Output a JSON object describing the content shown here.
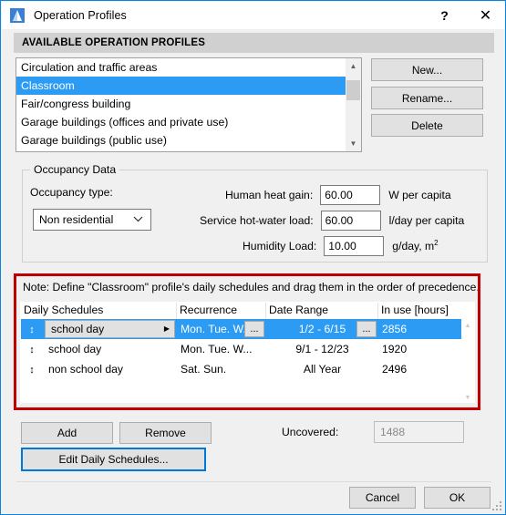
{
  "window": {
    "title": "Operation Profiles",
    "icon": "app-triangle-icon",
    "help_label": "?",
    "close_label": "✕"
  },
  "section": {
    "header": "AVAILABLE OPERATION PROFILES"
  },
  "profiles": {
    "items": [
      {
        "label": "Circulation and traffic areas",
        "selected": false
      },
      {
        "label": "Classroom",
        "selected": true
      },
      {
        "label": "Fair/congress building",
        "selected": false
      },
      {
        "label": "Garage buildings (offices and private use)",
        "selected": false
      },
      {
        "label": "Garage buildings (public use)",
        "selected": false
      }
    ],
    "scroll_up": "▲",
    "scroll_down": "▼"
  },
  "profile_actions": {
    "new": "New...",
    "rename": "Rename...",
    "delete": "Delete"
  },
  "occupancy": {
    "group_title": "Occupancy Data",
    "type_label": "Occupancy type:",
    "type_value": "Non residential",
    "type_chevron": "⌄",
    "fields": [
      {
        "label": "Human heat gain:",
        "value": "60.00",
        "unit": "W per capita"
      },
      {
        "label": "Service hot-water load:",
        "value": "60.00",
        "unit": "l/day per capita"
      },
      {
        "label": "Humidity Load:",
        "value": "10.00",
        "unit_prefix": "g/day, m",
        "unit_sup": "2"
      }
    ]
  },
  "schedules": {
    "note": "Note: Define \"Classroom\" profile's daily schedules and drag them in the order of precedence.",
    "columns": [
      "Daily Schedules",
      "Recurrence",
      "Date Range",
      "In use [hours]"
    ],
    "rows": [
      {
        "grip": "↕",
        "name": "school day",
        "recurrence": "Mon. Tue. W...",
        "date_range": "1/2 - 6/15",
        "in_use": "2856",
        "selected": true,
        "name_arrow": "▶",
        "ellipsis": "..."
      },
      {
        "grip": "↕",
        "name": "school day",
        "recurrence": "Mon. Tue. W...",
        "date_range": "9/1 - 12/23",
        "in_use": "1920",
        "selected": false
      },
      {
        "grip": "↕",
        "name": "non school day",
        "recurrence": "Sat. Sun.",
        "date_range": "All Year",
        "in_use": "2496",
        "selected": false
      }
    ],
    "scroll_up": "▲",
    "scroll_down": "▼"
  },
  "schedule_actions": {
    "add": "Add",
    "remove": "Remove",
    "edit": "Edit Daily Schedules..."
  },
  "uncovered": {
    "label": "Uncovered:",
    "value": "1488"
  },
  "dialog_actions": {
    "cancel": "Cancel",
    "ok": "OK"
  },
  "colors": {
    "accent_blue": "#2b9bf4",
    "window_border": "#0a84e0",
    "highlight_red": "#c00000",
    "focus_blue": "#0078d7"
  }
}
